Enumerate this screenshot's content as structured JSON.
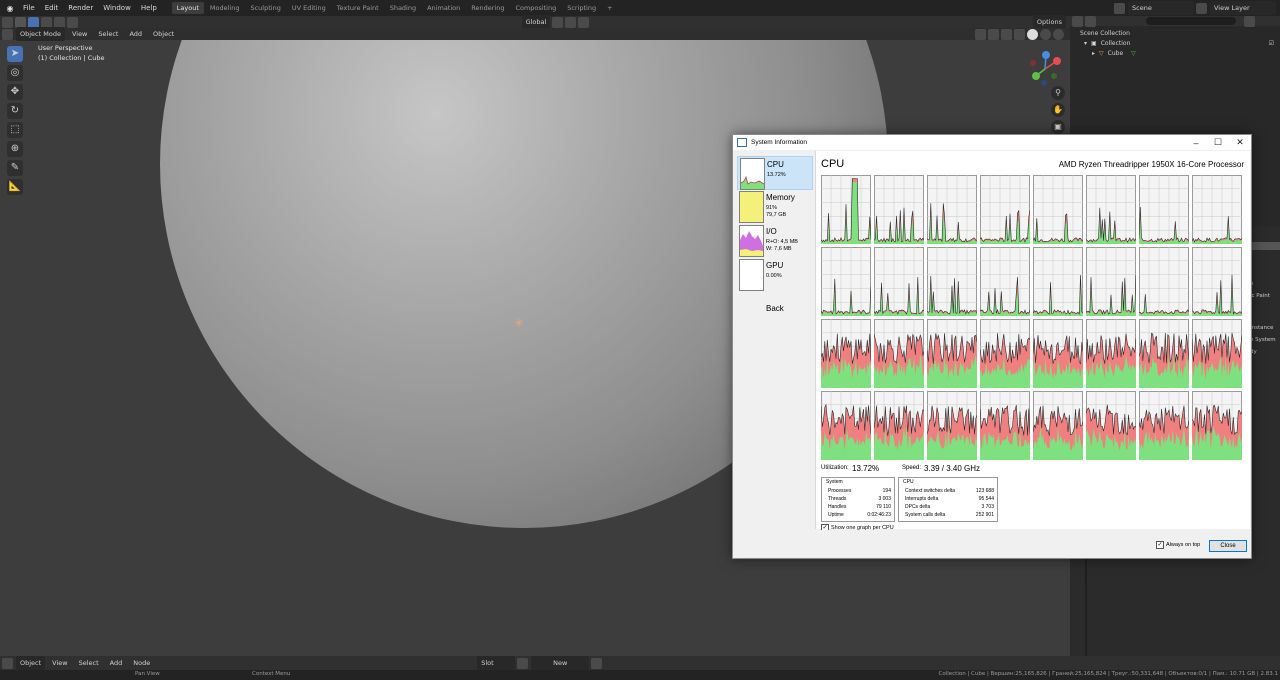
{
  "topbar": {
    "menus": [
      "File",
      "Edit",
      "Render",
      "Window",
      "Help"
    ],
    "workspaces": [
      "Layout",
      "Modeling",
      "Sculpting",
      "UV Editing",
      "Texture Paint",
      "Shading",
      "Animation",
      "Rendering",
      "Compositing",
      "Scripting"
    ],
    "active_workspace": "Layout",
    "add_workspace": "+",
    "scene": "Scene",
    "view_layer": "View Layer"
  },
  "viewport": {
    "mode": "Object Mode",
    "menus": [
      "View",
      "Select",
      "Add",
      "Object"
    ],
    "orientation": "Global",
    "options": "Options",
    "perspective": "User Perspective",
    "collection_label": "(1) Collection | Cube"
  },
  "outliner": {
    "scene_collection": "Scene Collection",
    "collection": "Collection",
    "object": "Cube",
    "search_placeholder": ""
  },
  "props_fragments": [
    "n",
    "ic Paint",
    "Instance",
    "e System",
    "dy"
  ],
  "timeline": {
    "mode": "Object",
    "menus": [
      "View",
      "Select",
      "Add",
      "Node"
    ],
    "slot": "Slot",
    "new": "New"
  },
  "statusbar": {
    "pan": "Pan View",
    "context": "Context Menu",
    "stats": "Collection | Cube | Вершин:25,165,826 | Граней:25,165,824 | Треуг.:50,331,648 | Объектов:0/1 | Пам.: 10.71 GB | 2.83.1"
  },
  "sysinfo": {
    "title": "System Information",
    "nav": [
      {
        "name": "CPU",
        "sub1": "13.72%",
        "sub2": ""
      },
      {
        "name": "Memory",
        "sub1": "91%",
        "sub2": "79,7 GB"
      },
      {
        "name": "I/O",
        "sub1": "R+O: 4,5 MB",
        "sub2": "W: 7,6 MB"
      },
      {
        "name": "GPU",
        "sub1": "0.00%",
        "sub2": ""
      }
    ],
    "back": "Back",
    "heading": "CPU",
    "processor": "AMD Ryzen Threadripper 1950X 16-Core Processor",
    "utilization_label": "Utilization:",
    "utilization": "13.72%",
    "speed_label": "Speed:",
    "speed": "3.39 / 3.40 GHz",
    "system_box": {
      "title": "System",
      "rows": [
        {
          "k": "Processes",
          "v": "194"
        },
        {
          "k": "Threads",
          "v": "3 003"
        },
        {
          "k": "Handles",
          "v": "79 110"
        },
        {
          "k": "Uptime",
          "v": "0:02:46:23"
        }
      ]
    },
    "cpu_box": {
      "title": "CPU",
      "rows": [
        {
          "k": "Context switches delta",
          "v": "123 688"
        },
        {
          "k": "Interrupts delta",
          "v": "95 544"
        },
        {
          "k": "DPCs delta",
          "v": "3 703"
        },
        {
          "k": "System calls delta",
          "v": "252 901"
        }
      ]
    },
    "one_graph": "Show one graph per CPU",
    "always_on_top": "Always on top",
    "close": "Close",
    "graph_count": 32,
    "colors": {
      "user": "#7ee07e",
      "kernel": "#f08080",
      "line": "#2a2a2a",
      "grid": "#c8c8c8",
      "memory": "#f5f07a",
      "io": "#d070e0"
    }
  }
}
